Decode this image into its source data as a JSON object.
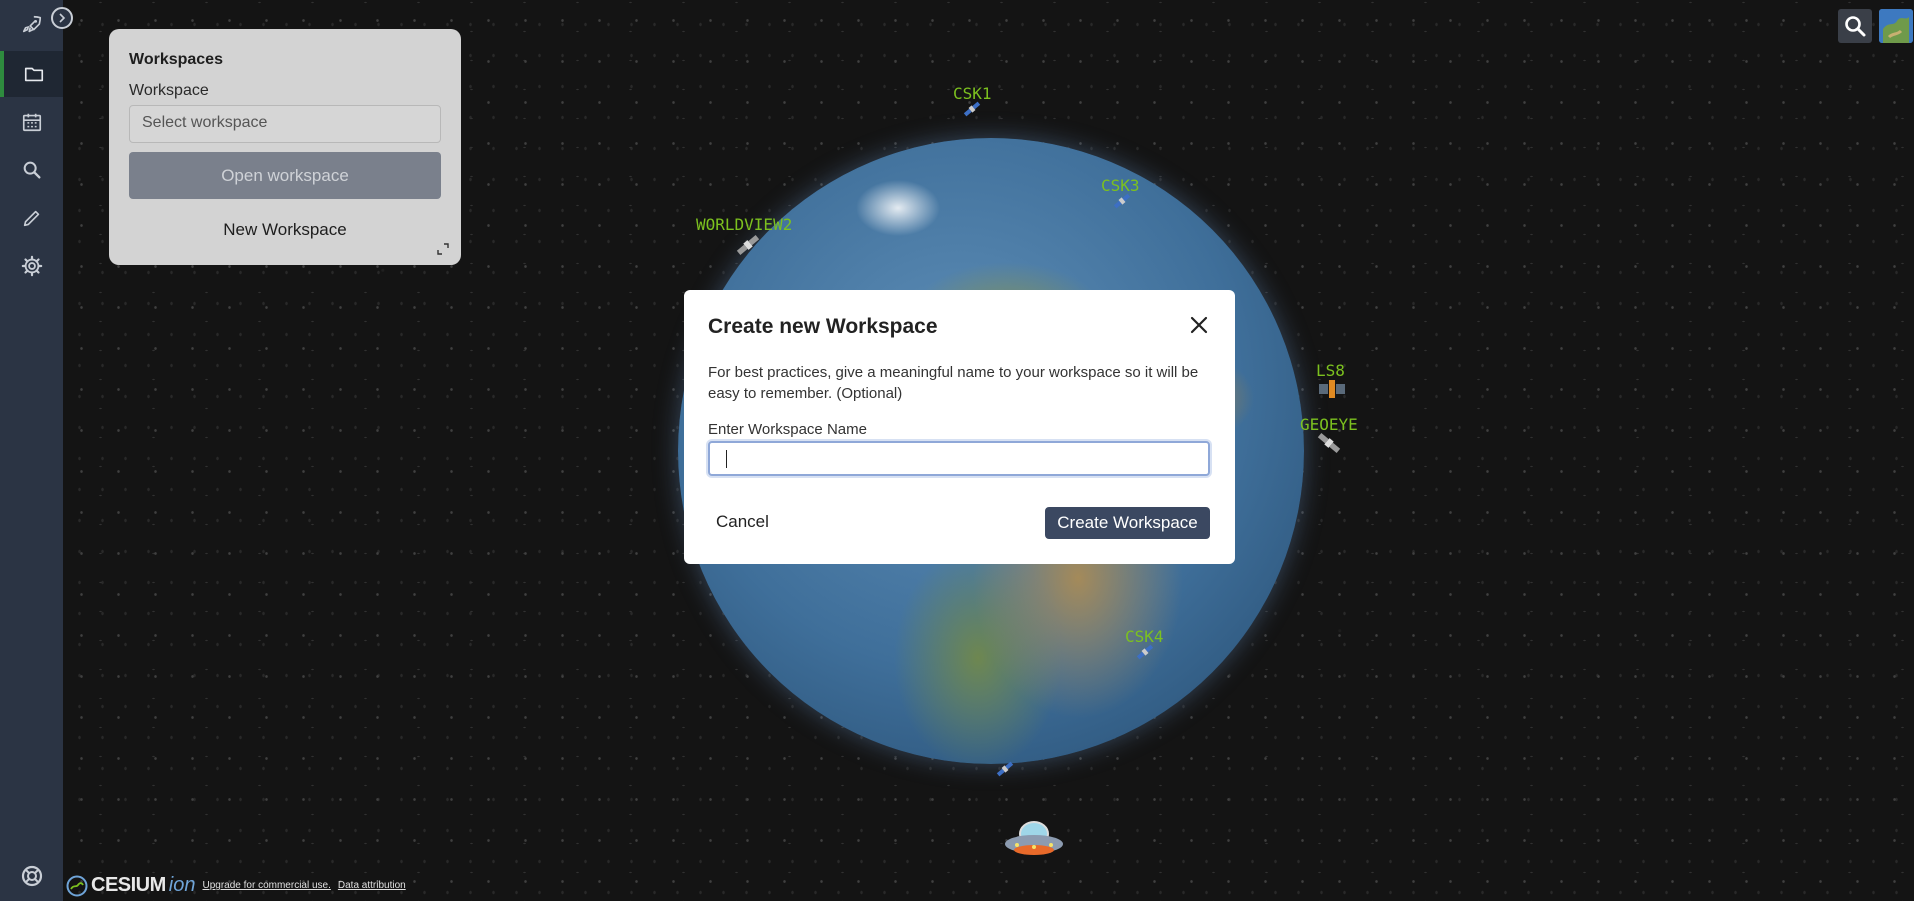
{
  "sidebar": {
    "items": [
      {
        "name": "launch",
        "icon": "rocket-icon"
      },
      {
        "name": "workspaces",
        "icon": "folder-icon",
        "active": true
      },
      {
        "name": "calendar",
        "icon": "calendar-icon"
      },
      {
        "name": "search",
        "icon": "search-icon"
      },
      {
        "name": "draw",
        "icon": "pencil-icon"
      },
      {
        "name": "settings",
        "icon": "gear-icon"
      }
    ],
    "help_icon": "lifebuoy-icon",
    "collapse_icon": "chevron-right-icon"
  },
  "workspaces_panel": {
    "title": "Workspaces",
    "workspace_label": "Workspace",
    "select_placeholder": "Select workspace",
    "open_button": "Open workspace",
    "new_button": "New Workspace"
  },
  "modal": {
    "title": "Create new Workspace",
    "description": "For best practices, give a meaningful name to your workspace so it will be easy to remember. (Optional)",
    "input_label": "Enter Workspace Name",
    "input_value": "",
    "cancel_label": "Cancel",
    "create_label": "Create Workspace"
  },
  "satellites": [
    {
      "label": "CSK1"
    },
    {
      "label": "CSK3"
    },
    {
      "label": "WORLDVIEW2"
    },
    {
      "label": "LS8"
    },
    {
      "label": "GEOEYE"
    },
    {
      "label": "CSK4"
    }
  ],
  "credits": {
    "logo_text": "CESIUM",
    "logo_suffix": "ion",
    "upgrade_link": "Upgrade for commercial use.",
    "attribution_link": "Data attribution"
  },
  "colors": {
    "sidebar": "#2b3444",
    "active_indicator": "#2e8b3e",
    "satellite_label": "#7cc11f",
    "primary_button": "#3b4861"
  }
}
